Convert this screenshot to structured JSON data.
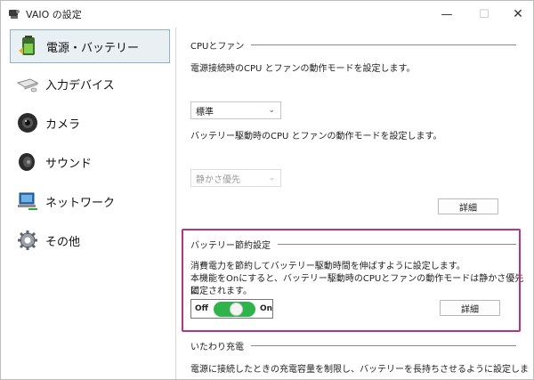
{
  "window": {
    "title": "VAIO の設定",
    "minimize": "—",
    "maximize": "☐",
    "close": "✕"
  },
  "sidebar": {
    "items": [
      {
        "label": "電源・バッテリー",
        "icon": "battery-icon",
        "active": true
      },
      {
        "label": "入力デバイス",
        "icon": "keyboard-icon",
        "active": false
      },
      {
        "label": "カメラ",
        "icon": "camera-icon",
        "active": false
      },
      {
        "label": "サウンド",
        "icon": "speaker-icon",
        "active": false
      },
      {
        "label": "ネットワーク",
        "icon": "network-icon",
        "active": false
      },
      {
        "label": "その他",
        "icon": "gear-icon",
        "active": false
      }
    ]
  },
  "cpu_fan": {
    "heading": "CPUとファン",
    "ac_description": "電源接続時のCPU とファンの動作モードを設定します。",
    "ac_mode": "標準",
    "battery_description": "バッテリー駆動時のCPU とファンの動作モードを設定します。",
    "battery_mode": "静かさ優先",
    "detail_label": "詳細"
  },
  "battery_saver": {
    "heading": "バッテリー節約設定",
    "description_1": "消費電力を節約してバッテリー駆動時間を伸ばすように設定します。",
    "description_2": "本機能をOnにすると、バッテリー駆動時のCPUとファンの動作モードは静かさ優先に",
    "description_3": "固定されます。",
    "toggle_off": "Off",
    "toggle_on": "On",
    "toggle_state": "on",
    "detail_label": "詳細"
  },
  "care_charging": {
    "heading": "いたわり充電",
    "description": "電源に接続したときの充電容量を制限し、バッテリーを長持ちさせるように設定しま"
  },
  "colors": {
    "accent_highlight": "#b5357f",
    "toggle_on": "#2fb34b",
    "active_nav_bg": "#e8f0f3"
  }
}
